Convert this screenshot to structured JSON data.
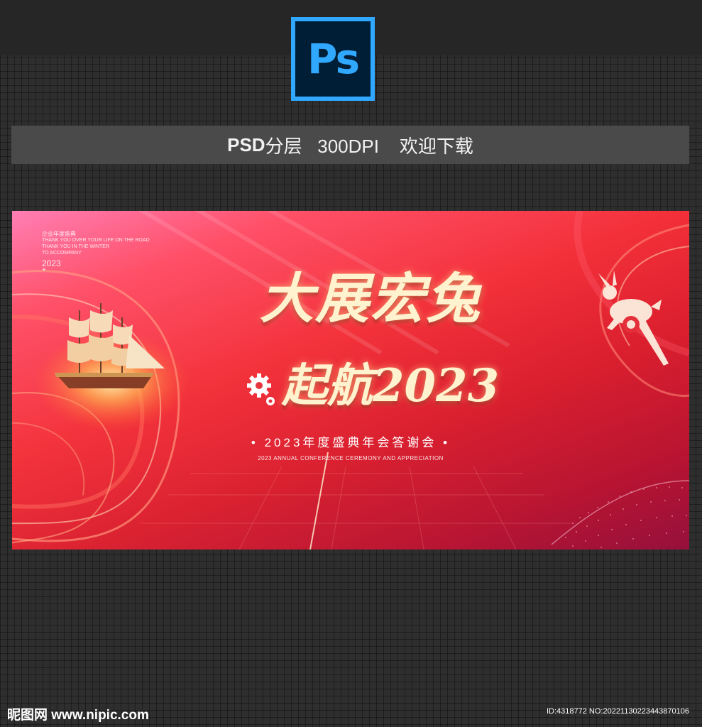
{
  "ps_logo": {
    "text": "Ps",
    "icon": "photoshop-icon",
    "border_color": "#31a8ff",
    "bg_color": "#001e36"
  },
  "info_bar": {
    "psd": "PSD",
    "rest": "分层   300DPI    欢迎下载"
  },
  "banner": {
    "small_cn": "企业年度盛典",
    "small_en_1": "THANK YOU OVER YOUR LIFE ON THE ROAD",
    "small_en_2": "THANK YOU IN THE WINTER",
    "small_en_3": "TO ACCOMPANY",
    "small_year": "2023",
    "small_plus": "+",
    "headline_line1": "大展宏兔",
    "headline_line2": "起航2023",
    "subtitle_cn": "• 2023年度盛典年会答谢会 •",
    "subtitle_en": "2023 ANNUAL CONFERENCE CEREMONY AND APPRECIATION",
    "accent_gold": "#fff3cf",
    "bg_red": "#e81c28"
  },
  "watermark": {
    "site": "昵图网 www.nipic.com",
    "id": "ID:4318772 NO:20221130223443870106"
  }
}
